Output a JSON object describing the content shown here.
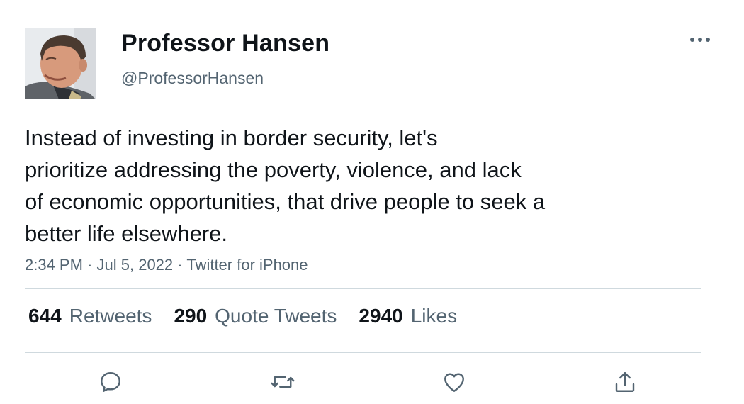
{
  "author": {
    "name": "Professor Hansen",
    "handle": "@ProfessorHansen"
  },
  "tweet": {
    "text_lines": [
      "Instead of investing in border security, let's",
      "prioritize addressing the poverty, violence, and lack",
      "of economic opportunities, that drive people to seek a",
      "better life elsewhere."
    ],
    "time": "2:34 PM",
    "separator": "·",
    "date": "Jul 5, 2022",
    "source": "Twitter for iPhone"
  },
  "stats": {
    "retweets": {
      "count": "644",
      "label": "Retweets"
    },
    "quotes": {
      "count": "290",
      "label": "Quote Tweets"
    },
    "likes": {
      "count": "2940",
      "label": "Likes"
    }
  },
  "icons": {
    "more": "more-horizontal-icon",
    "reply": "reply-icon",
    "retweet": "retweet-icon",
    "like": "heart-icon",
    "share": "share-icon"
  },
  "colors": {
    "text_primary": "#0f1419",
    "text_secondary": "#536471",
    "divider": "#cfd9de"
  }
}
